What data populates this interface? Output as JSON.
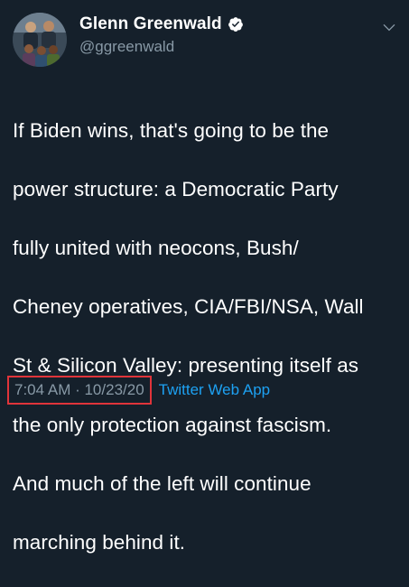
{
  "author": {
    "display_name": "Glenn Greenwald",
    "handle": "@ggreenwald",
    "verified": true
  },
  "tweet": {
    "text": "If Biden wins, that's going to be the power structure: a Democratic Party fully united with neocons, Bush/ Cheney operatives, CIA/FBI/NSA, Wall St & Silicon Valley: presenting itself as the only protection against fascism. And much of the left will continue marching behind it.",
    "lines": [
      "If Biden wins, that's going to be the",
      "power structure: a Democratic Party",
      "fully united with neocons, Bush/",
      "Cheney operatives, CIA/FBI/NSA, Wall",
      "St & Silicon Valley: presenting itself as",
      "the only protection against fascism.",
      "And much of the left will continue",
      "marching behind it."
    ],
    "time": "7:04 AM · 10/23/20",
    "source": "Twitter Web App"
  },
  "icons": {
    "verified": "verified-badge-icon",
    "menu": "chevron-down-icon"
  },
  "colors": {
    "background": "#15202b",
    "text": "#ffffff",
    "secondary_text": "#8899a6",
    "link": "#1da1f2",
    "highlight_box": "#e0343a"
  }
}
